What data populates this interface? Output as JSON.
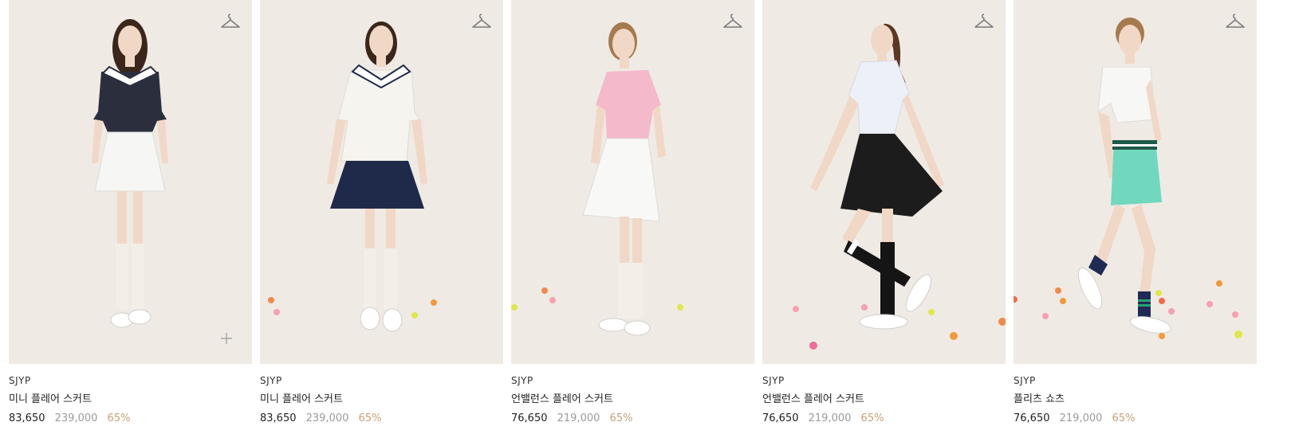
{
  "products": [
    {
      "brand": "SJYP",
      "name": "미니 플레어 스커트",
      "price": "83,650",
      "original_price": "239,000",
      "discount": "65%",
      "top_color": "#2b2f3d",
      "bottom_color": "#f6f6f4",
      "sock_color": "#f3efe8",
      "hair_color": "#3a261b"
    },
    {
      "brand": "SJYP",
      "name": "미니 플레어 스커트",
      "price": "83,650",
      "original_price": "239,000",
      "discount": "65%",
      "top_color": "#f6f4ef",
      "bottom_color": "#1f2a4a",
      "sock_color": "#f3efe8",
      "hair_color": "#3a261b"
    },
    {
      "brand": "SJYP",
      "name": "언밸런스 플레어 스커트",
      "price": "76,650",
      "original_price": "219,000",
      "discount": "65%",
      "top_color": "#f5b9cc",
      "bottom_color": "#f8f8f6",
      "sock_color": "#f3efe8",
      "hair_color": "#a57a4e"
    },
    {
      "brand": "SJYP",
      "name": "언밸런스 플레어 스커트",
      "price": "76,650",
      "original_price": "219,000",
      "discount": "65%",
      "top_color": "#eef0f8",
      "bottom_color": "#1c1c1c",
      "sock_color": "#151515",
      "hair_color": "#5a3825"
    },
    {
      "brand": "SJYP",
      "name": "플리츠 쇼츠",
      "price": "76,650",
      "original_price": "219,000",
      "discount": "65%",
      "top_color": "#f7f7f5",
      "bottom_color": "#6fd8bd",
      "sock_color": "#1e2c55",
      "hair_color": "#a57a4e"
    }
  ],
  "icons": {
    "wishlist": "hanger-icon",
    "quick_add": "plus-icon"
  },
  "colors": {
    "photo_background": "#efeae4",
    "discount": "#c8a07a",
    "original_price": "#9a9a9a"
  }
}
